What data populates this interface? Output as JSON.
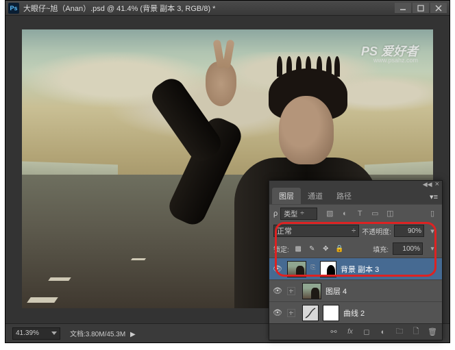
{
  "titlebar": {
    "app_icon": "Ps",
    "title": "大眼仔~旭（Anan）.psd @ 41.4% (背景 副本 3, RGB/8) *"
  },
  "watermark": {
    "main": "PS 爱好者",
    "sub": "www.psahz.com"
  },
  "statusbar": {
    "zoom": "41.39%",
    "doc_label": "文档:",
    "doc_size": "3.80M/45.3M"
  },
  "panel": {
    "tabs": {
      "layers": "图层",
      "channels": "通道",
      "paths": "路径"
    },
    "filter_label": "类型",
    "toolbar_icons": [
      "image-filter",
      "adjustment-filter",
      "type-filter",
      "shape-filter",
      "smart-filter"
    ],
    "blend_mode": "正常",
    "opacity_label": "不透明度:",
    "opacity_value": "90%",
    "lock_label": "锁定:",
    "fill_label": "填充:",
    "fill_value": "100%",
    "layers": [
      {
        "name": "背景 副本 3",
        "visible": true,
        "selected": true,
        "hasMask": true,
        "type": "photo"
      },
      {
        "name": "图层 4",
        "visible": true,
        "selected": false,
        "hasMask": false,
        "type": "photo"
      },
      {
        "name": "曲线 2",
        "visible": true,
        "selected": false,
        "hasMask": true,
        "type": "adjustment"
      }
    ],
    "bottom_icons": [
      "link",
      "fx",
      "mask",
      "adjustment",
      "group",
      "new-layer",
      "delete"
    ]
  }
}
